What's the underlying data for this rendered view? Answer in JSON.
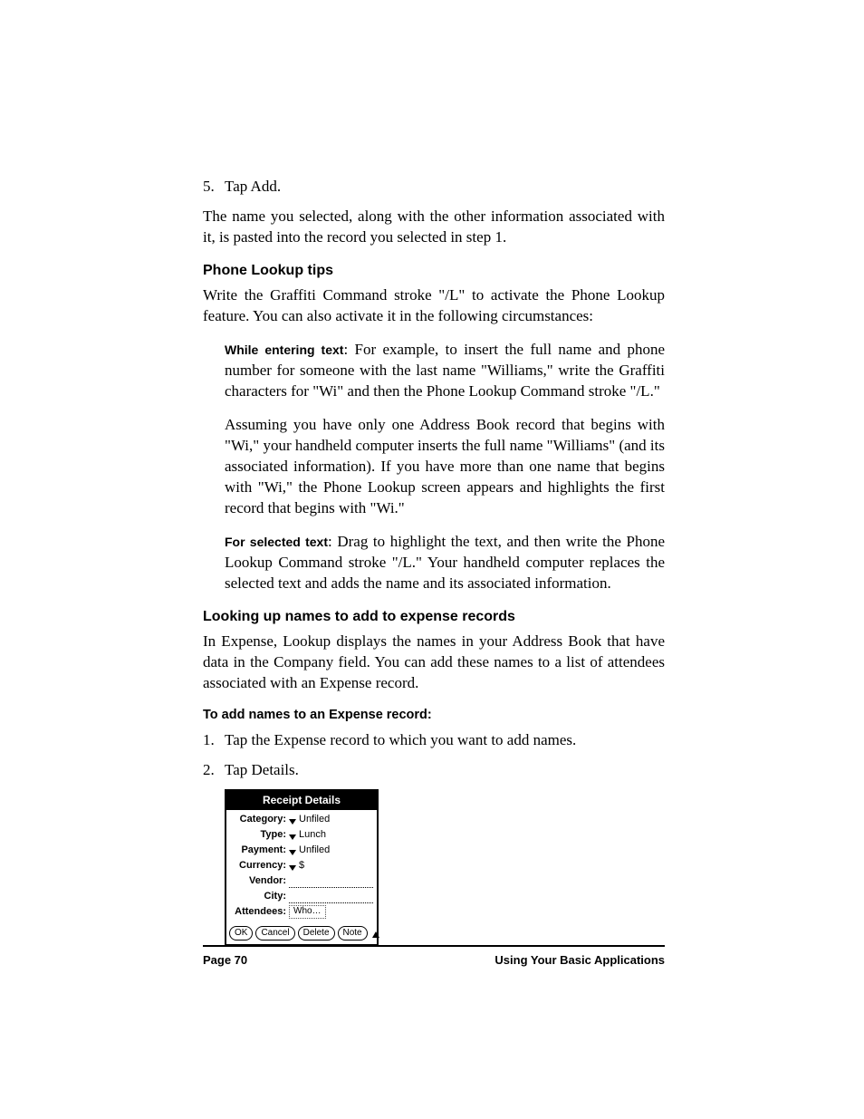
{
  "step5": {
    "num": "5.",
    "text": "Tap Add."
  },
  "para_after_step5": "The name you selected, along with the other information associated with it, is pasted into the record you selected in step 1.",
  "heading_tips": "Phone Lookup tips",
  "para_tips_intro": "Write the Graffiti Command stroke \"/L\" to activate the Phone Lookup feature. You can also activate it in the following circumstances:",
  "tip1": {
    "lead": "While entering text",
    "rest": ": For example, to insert the full name and phone number for someone with the last name \"Williams,\" write the Graffiti characters for \"Wi\" and then the Phone Lookup Command stroke \"/L.\""
  },
  "tip1_followup": "Assuming you have only one Address Book record that begins with \"Wi,\" your handheld computer inserts the full name \"Williams\" (and its associated information). If you have more than one name that begins with \"Wi,\" the Phone Lookup screen appears and highlights the first record that begins with \"Wi.\"",
  "tip2": {
    "lead": "For selected text",
    "rest": ": Drag to highlight the text, and then write the Phone Lookup Command stroke \"/L.\" Your handheld computer replaces the selected text and adds the name and its associated information."
  },
  "heading_lookup_expense": "Looking up names to add to expense records",
  "para_expense_intro": "In Expense, Lookup displays the names in your Address Book that have data in the Company field. You can add these names to a list of attendees associated with an Expense record.",
  "heading_to_add": "To add names to an Expense record:",
  "steps_expense": [
    {
      "num": "1.",
      "text": "Tap the Expense record to which you want to add names."
    },
    {
      "num": "2.",
      "text": "Tap Details."
    }
  ],
  "dialog": {
    "title": "Receipt Details",
    "fields": {
      "category": {
        "label": "Category:",
        "value": "Unfiled"
      },
      "type": {
        "label": "Type:",
        "value": "Lunch"
      },
      "payment": {
        "label": "Payment:",
        "value": "Unfiled"
      },
      "currency": {
        "label": "Currency:",
        "value": "$"
      },
      "vendor": {
        "label": "Vendor:"
      },
      "city": {
        "label": "City:"
      },
      "attendees": {
        "label": "Attendees:",
        "button": "Who…"
      }
    },
    "buttons": {
      "ok": "OK",
      "cancel": "Cancel",
      "delete": "Delete",
      "note": "Note"
    }
  },
  "footer": {
    "left": "Page 70",
    "right": "Using Your Basic Applications"
  }
}
